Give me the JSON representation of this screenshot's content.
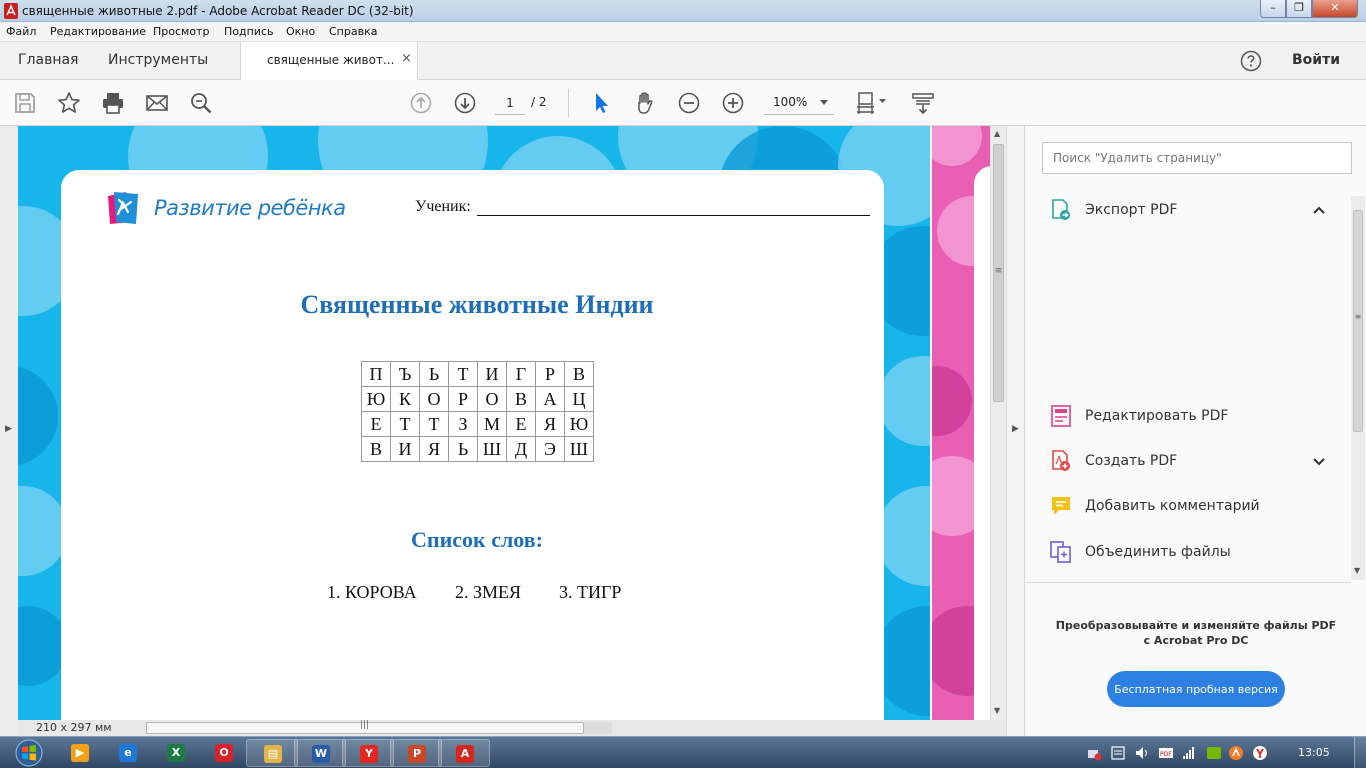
{
  "window": {
    "title": "священные животные 2.pdf - Adobe Acrobat Reader DC (32-bit)",
    "controls": {
      "minimize": "–",
      "maximize": "❐",
      "close": "✕"
    }
  },
  "menu": [
    "Файл",
    "Редактирование",
    "Просмотр",
    "Подпись",
    "Окно",
    "Справка"
  ],
  "tabs": {
    "home": "Главная",
    "tools": "Инструменты",
    "doc": "священные живот...",
    "doc_close": "×",
    "signin": "Войти"
  },
  "toolbar": {
    "icons": [
      "save-icon",
      "bookmark-star-icon",
      "print-icon",
      "email-icon",
      "zoom-search-icon",
      "page-up-icon",
      "page-down-icon",
      "select-cursor-icon",
      "hand-tool-icon",
      "zoom-out-icon",
      "zoom-in-icon",
      "fit-page-icon",
      "read-mode-icon"
    ],
    "page_current": "1",
    "page_total": "/ 2",
    "zoom": "100%"
  },
  "document": {
    "brand_logo": "Развитие ребёнка",
    "pupil_label": "Ученик:",
    "title": "Священные животные Индии",
    "grid": [
      [
        "П",
        "Ъ",
        "Ь",
        "Т",
        "И",
        "Г",
        "Р",
        "В"
      ],
      [
        "Ю",
        "К",
        "О",
        "Р",
        "О",
        "В",
        "А",
        "Ц"
      ],
      [
        "Е",
        "Т",
        "Т",
        "З",
        "М",
        "Е",
        "Я",
        "Ю"
      ],
      [
        "В",
        "И",
        "Я",
        "Ь",
        "Ш",
        "Д",
        "Э",
        "Ш"
      ]
    ],
    "wordlist_title": "Список слов:",
    "words": [
      "1. КОРОВА",
      "2. ЗМЕЯ",
      "3. ТИГР"
    ],
    "colors": {
      "heading": "#1f6fb8",
      "background": "#17b5e9",
      "next_page": "#e95fb4"
    }
  },
  "status": {
    "page_size": "210 x 297 мм"
  },
  "panel": {
    "search_placeholder": "Поиск \"Удалить страницу\"",
    "tools": [
      {
        "label": "Экспорт PDF",
        "icon": "export-pdf-icon"
      },
      {
        "label": "Редактировать PDF",
        "icon": "edit-pdf-icon"
      },
      {
        "label": "Создать PDF",
        "icon": "create-pdf-icon"
      },
      {
        "label": "Добавить комментарий",
        "icon": "comment-icon"
      },
      {
        "label": "Объединить файлы",
        "icon": "combine-files-icon"
      }
    ],
    "promo_line1": "Преобразовывайте и изменяйте файлы PDF",
    "promo_line2": "с Acrobat Pro DC",
    "trial_button": "Бесплатная пробная версия"
  },
  "taskbar": {
    "apps": [
      {
        "name": "media-player",
        "glyph": "▶",
        "color": "#f2a218"
      },
      {
        "name": "internet-explorer",
        "glyph": "e",
        "color": "#1e78d6"
      },
      {
        "name": "excel",
        "glyph": "X",
        "color": "#1f7a44"
      },
      {
        "name": "opera",
        "glyph": "O",
        "color": "#d8232a"
      },
      {
        "name": "file-explorer",
        "glyph": "▤",
        "color": "#e2b54a"
      },
      {
        "name": "word",
        "glyph": "W",
        "color": "#2a5aa8"
      },
      {
        "name": "yandex-browser",
        "glyph": "Y",
        "color": "#e52620"
      },
      {
        "name": "powerpoint",
        "glyph": "P",
        "color": "#c8482a"
      },
      {
        "name": "acrobat-reader",
        "glyph": "A",
        "color": "#d4281f"
      }
    ],
    "clock": "13:05"
  }
}
